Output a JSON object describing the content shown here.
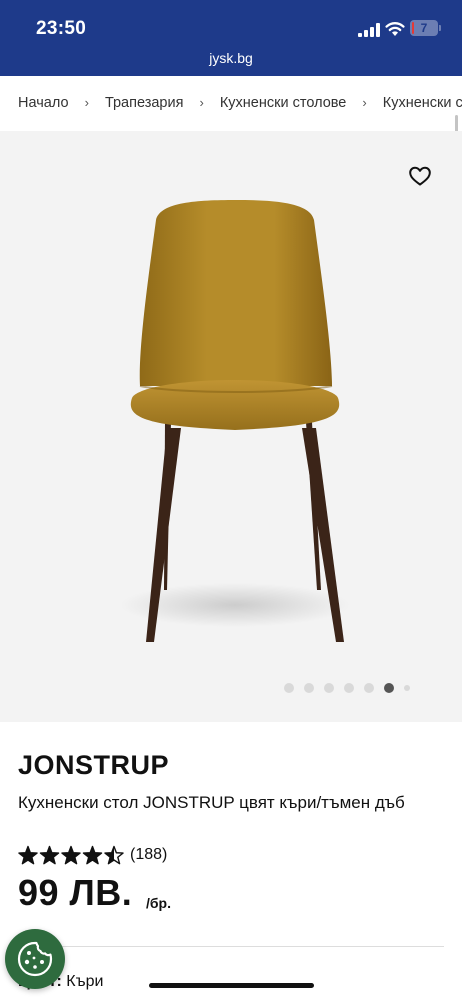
{
  "status_bar": {
    "time": "23:50",
    "battery": "7",
    "battery_level_percent": 7,
    "url": "jysk.bg",
    "background_color": "#1e3a8a"
  },
  "breadcrumb": {
    "items": [
      "Начало",
      "Трапезария",
      "Кухненски столове",
      "Кухненски с"
    ],
    "separator": "›"
  },
  "gallery": {
    "icons": [
      "heart-icon",
      "chair-image"
    ],
    "image_count": 7,
    "active_image": 6
  },
  "product": {
    "name": "JONSTRUP",
    "description": "Кухненски стол JONSTRUP цвят къри/тъмен дъб",
    "rating": 4.5,
    "rating_max": 5,
    "rating_count": "(188)",
    "price": "99 ЛВ.",
    "price_unit": "/бр.",
    "color_label": "Цвят:",
    "color_value": "Къри",
    "chair_color": "#b58c2a",
    "leg_color": "#3b2418"
  },
  "cookie_button": {
    "icon": "cookie-icon",
    "color": "#2e6b3e"
  }
}
